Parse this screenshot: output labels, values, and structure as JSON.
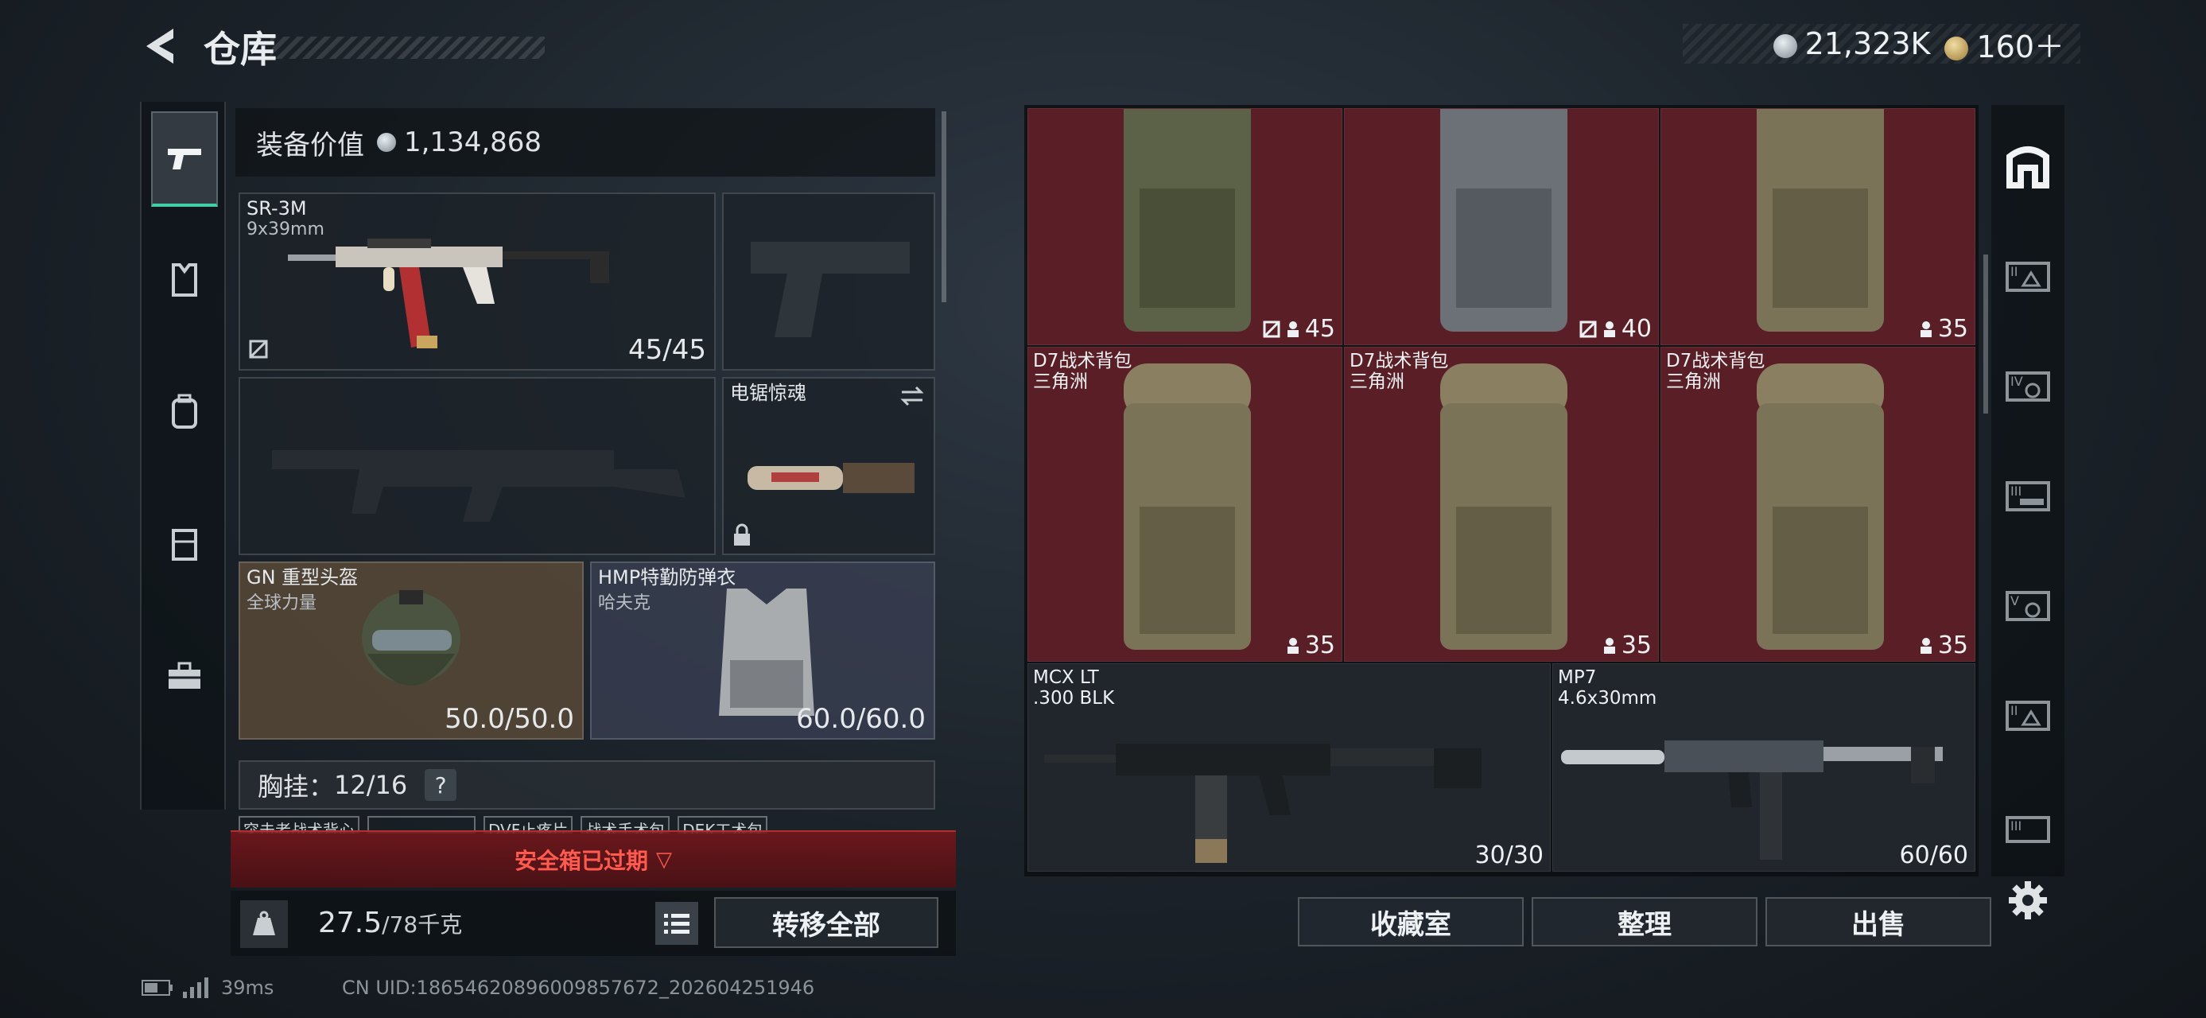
{
  "header": {
    "title": "仓库",
    "currency_silver": "21,323K",
    "currency_gold": "160＋"
  },
  "left_tabs": [
    {
      "icon": "pistol-icon",
      "active": true
    },
    {
      "icon": "armor-icon",
      "active": false
    },
    {
      "icon": "backpack-icon",
      "active": false
    },
    {
      "icon": "rig-icon",
      "active": false
    },
    {
      "icon": "toolbox-icon",
      "active": false
    }
  ],
  "equipment": {
    "value_label": "装备价值",
    "value": "1,134,868",
    "primary_weapon": {
      "name": "SR-3M",
      "caliber": "9x39mm",
      "ammo": "45/45"
    },
    "melee": {
      "name": "电锯惊魂"
    },
    "helmet": {
      "name": "GN 重型头盔",
      "sub": "全球力量",
      "durability": "50.0/50.0"
    },
    "armor": {
      "name": "HMP特勤防弹衣",
      "sub": "哈夫克",
      "durability": "60.0/60.0"
    },
    "chest_rig_label": "胸挂：",
    "chest_rig_count": "12/16",
    "help": "?",
    "rig_items": [
      "突击者战术背心",
      "",
      "DVF止疼片",
      "战术手术包",
      "DEK工术包"
    ],
    "safebox_text": "安全箱已过期",
    "weight": "27.5",
    "weight_max": "/78千克",
    "transfer_all": "转移全部"
  },
  "stash": {
    "row1": [
      {
        "count": "45",
        "flag": true
      },
      {
        "count": "40",
        "flag": true
      },
      {
        "count": "35",
        "flag": false
      }
    ],
    "row2": [
      {
        "name": "D7战术背包",
        "sub": "三角洲",
        "count": "35"
      },
      {
        "name": "D7战术背包",
        "sub": "三角洲",
        "count": "35"
      },
      {
        "name": "D7战术背包",
        "sub": "三角洲",
        "count": "35"
      }
    ],
    "row3": [
      {
        "name": "MCX LT",
        "sub": ".300 BLK",
        "count": "30/30"
      },
      {
        "name": "MP7",
        "sub": "4.6x30mm",
        "count": "60/60"
      }
    ]
  },
  "bottom_buttons": {
    "collection": "收藏室",
    "sort": "整理",
    "sell": "出售"
  },
  "right_tabs": [
    "house-icon",
    "tier-2-icon",
    "tier-4-icon",
    "tier-3-icon",
    "tier-5-icon",
    "tier-2b-icon",
    "tier-3b-icon"
  ],
  "status": {
    "ping": "39ms",
    "uid": "CN UID:1865462089600985767​2_202604251946"
  },
  "colors": {
    "accent": "#3fd0a6",
    "stash_red": "#5a1f26",
    "warning_red": "#ff5a4e"
  }
}
